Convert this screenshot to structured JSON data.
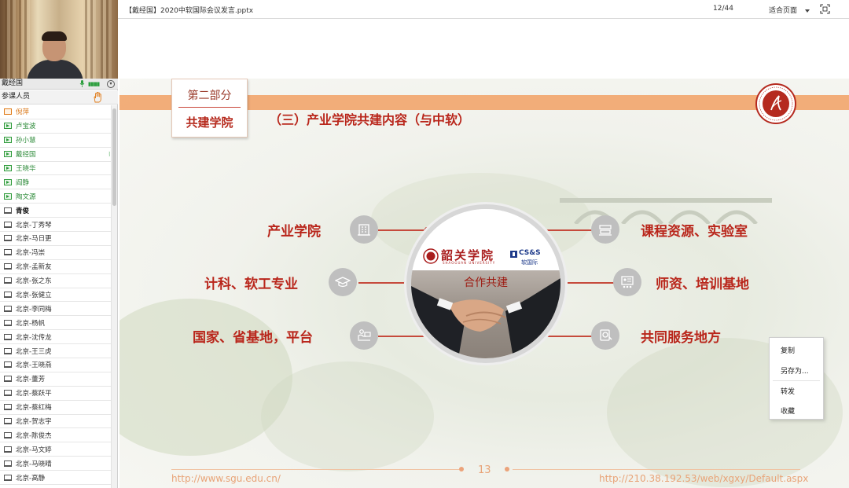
{
  "video": {
    "name": "戴经国"
  },
  "participants": {
    "header": "参课人员",
    "items": [
      {
        "name": "倪萍",
        "style": "orange",
        "icon": "host"
      },
      {
        "name": "卢宝波",
        "style": "green",
        "icon": "screen-green"
      },
      {
        "name": "孙小慧",
        "style": "green",
        "icon": "screen-green"
      },
      {
        "name": "戴经国",
        "style": "green",
        "icon": "screen-green",
        "speaking": true
      },
      {
        "name": "王晓华",
        "style": "green",
        "icon": "screen-green"
      },
      {
        "name": "阎静",
        "style": "green",
        "icon": "screen-green"
      },
      {
        "name": "陶文源",
        "style": "green",
        "icon": "screen-green"
      },
      {
        "name": "青俊",
        "style": "bold",
        "icon": "screen"
      },
      {
        "name": "北京-丁秀琴",
        "style": "normal",
        "icon": "screen"
      },
      {
        "name": "北京-马日更",
        "style": "normal",
        "icon": "screen"
      },
      {
        "name": "北京-冯崇",
        "style": "normal",
        "icon": "screen"
      },
      {
        "name": "北京-孟新友",
        "style": "normal",
        "icon": "screen"
      },
      {
        "name": "北京-张之东",
        "style": "normal",
        "icon": "screen"
      },
      {
        "name": "北京-张健立",
        "style": "normal",
        "icon": "screen"
      },
      {
        "name": "北京-李同梅",
        "style": "normal",
        "icon": "screen"
      },
      {
        "name": "北京-杨帆",
        "style": "normal",
        "icon": "screen"
      },
      {
        "name": "北京-沈传龙",
        "style": "normal",
        "icon": "screen"
      },
      {
        "name": "北京-王三虎",
        "style": "normal",
        "icon": "screen"
      },
      {
        "name": "北京-王晓燕",
        "style": "normal",
        "icon": "screen"
      },
      {
        "name": "北京-董芳",
        "style": "normal",
        "icon": "screen"
      },
      {
        "name": "北京-蔡跃平",
        "style": "normal",
        "icon": "screen"
      },
      {
        "name": "北京-蔡红梅",
        "style": "normal",
        "icon": "screen"
      },
      {
        "name": "北京-贺志宇",
        "style": "normal",
        "icon": "screen"
      },
      {
        "name": "北京-陈俊杰",
        "style": "normal",
        "icon": "screen"
      },
      {
        "name": "北京-马文婷",
        "style": "normal",
        "icon": "screen"
      },
      {
        "name": "北京-马晓晴",
        "style": "normal",
        "icon": "screen"
      },
      {
        "name": "北京-高静",
        "style": "normal",
        "icon": "screen"
      }
    ]
  },
  "doc_bar": {
    "title": "【戴经国】2020中软国际会议发言.pptx",
    "page_indicator": "12/44",
    "fit_mode": "适合页面"
  },
  "slide": {
    "section_top": "第二部分",
    "section_bottom": "共建学院",
    "title": "（三）产业学院共建内容（与中软）",
    "center": {
      "sgu_name": "韶关学院",
      "sgu_sub": "SHAOGUAN UNIVERSITY",
      "partner_logo": "CS&S",
      "partner_sub": "软国际",
      "label": "合作共建"
    },
    "left_items": [
      {
        "label": "产业学院",
        "icon": "building-icon"
      },
      {
        "label": "计科、软工专业",
        "icon": "graduation-cap-icon"
      },
      {
        "label": "国家、省基地，平台",
        "icon": "workstation-icon"
      }
    ],
    "right_items": [
      {
        "label": "课程资源、实验室",
        "icon": "books-icon"
      },
      {
        "label": "师资、培训基地",
        "icon": "training-icon"
      },
      {
        "label": "共同服务地方",
        "icon": "service-icon"
      }
    ],
    "footer_left": "http://www.sgu.edu.cn/",
    "footer_page": "13",
    "footer_right": "http://210.38.192.53/web/xgxy/Default.aspx"
  },
  "context_menu": {
    "items": [
      "复制",
      "另存为...",
      "转发",
      "收藏"
    ]
  },
  "colors": {
    "accent_red": "#b9261b",
    "band_orange": "#f2a56b",
    "online_green": "#2e8b3a",
    "host_orange": "#d9730f"
  }
}
